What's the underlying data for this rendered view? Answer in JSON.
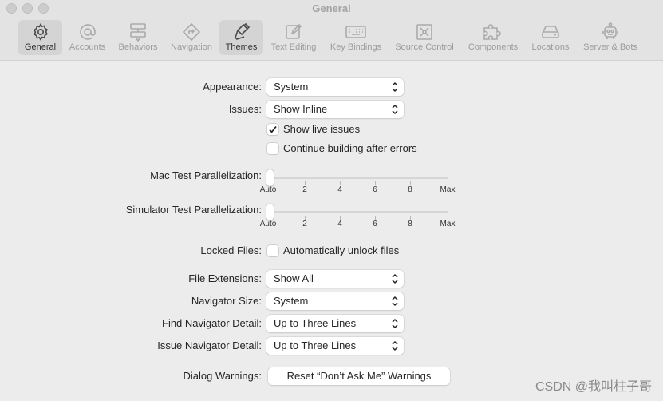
{
  "window": {
    "title": "General"
  },
  "toolbar": {
    "tabs": [
      {
        "label": "General",
        "icon": "gear-icon",
        "active": true
      },
      {
        "label": "Accounts",
        "icon": "at-icon"
      },
      {
        "label": "Behaviors",
        "icon": "behaviors-icon"
      },
      {
        "label": "Navigation",
        "icon": "navigation-icon"
      },
      {
        "label": "Themes",
        "icon": "brush-icon"
      },
      {
        "label": "Text Editing",
        "icon": "pencil-icon"
      },
      {
        "label": "Key Bindings",
        "icon": "keyboard-icon"
      },
      {
        "label": "Source Control",
        "icon": "source-control-icon"
      },
      {
        "label": "Components",
        "icon": "puzzle-icon"
      },
      {
        "label": "Locations",
        "icon": "drive-icon"
      },
      {
        "label": "Server & Bots",
        "icon": "robot-icon"
      }
    ]
  },
  "form": {
    "appearance": {
      "label": "Appearance:",
      "value": "System"
    },
    "issues": {
      "label": "Issues:",
      "value": "Show Inline"
    },
    "show_live_issues": {
      "label": "Show live issues",
      "checked": true
    },
    "continue_building": {
      "label": "Continue building after errors",
      "checked": false
    },
    "mac_parallel": {
      "label": "Mac Test Parallelization:",
      "value": "Auto"
    },
    "sim_parallel": {
      "label": "Simulator Test Parallelization:",
      "value": "Auto"
    },
    "slider_ticks": [
      "Auto",
      "2",
      "4",
      "6",
      "8",
      "Max"
    ],
    "locked_files": {
      "label": "Locked Files:",
      "checkbox_label": "Automatically unlock files",
      "checked": false
    },
    "file_extensions": {
      "label": "File Extensions:",
      "value": "Show All"
    },
    "navigator_size": {
      "label": "Navigator Size:",
      "value": "System"
    },
    "find_navigator_detail": {
      "label": "Find Navigator Detail:",
      "value": "Up to Three Lines"
    },
    "issue_navigator_detail": {
      "label": "Issue Navigator Detail:",
      "value": "Up to Three Lines"
    },
    "dialog_warnings": {
      "label": "Dialog Warnings:",
      "button": "Reset “Don’t Ask Me” Warnings"
    }
  },
  "watermark": "CSDN @我叫柱子哥"
}
